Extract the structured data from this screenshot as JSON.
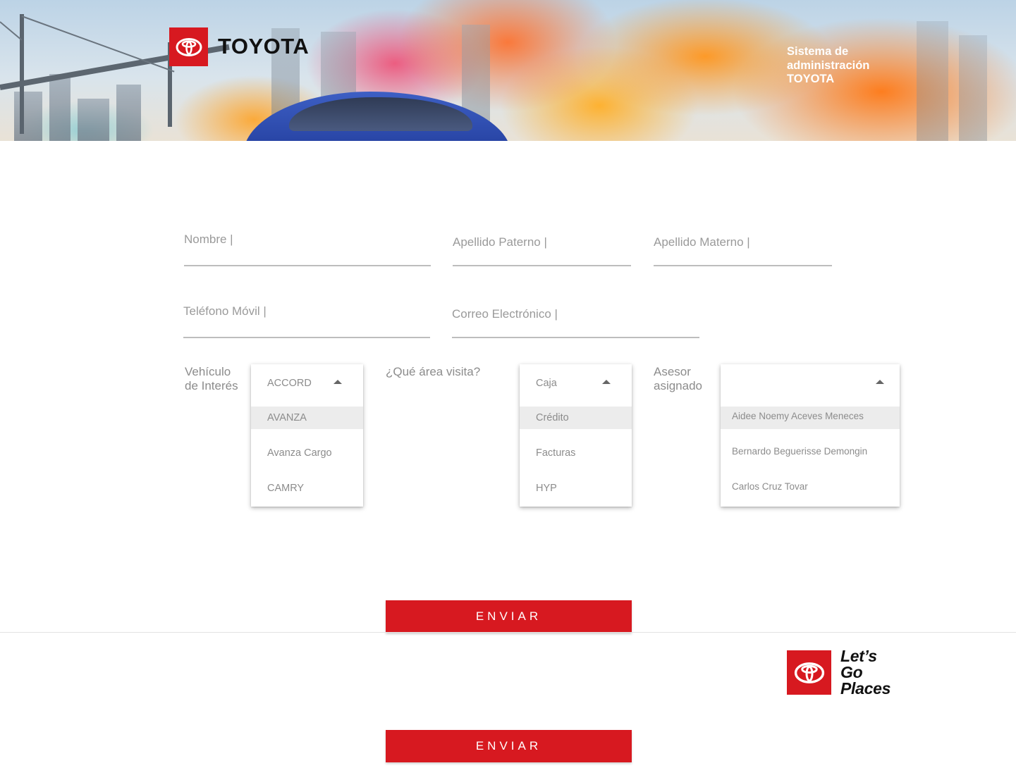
{
  "header": {
    "brand_name": "TOYOTA",
    "system_title": [
      "Sistema de",
      "administración",
      "TOYOTA"
    ]
  },
  "form": {
    "nombre": {
      "placeholder": "Nombre |"
    },
    "apellido_paterno": {
      "placeholder": "Apellido Paterno |"
    },
    "apellido_materno": {
      "placeholder": "Apellido Materno |"
    },
    "telefono": {
      "placeholder": "Teléfono Móvil |"
    },
    "correo": {
      "placeholder": "Correo Electrónico |"
    },
    "vehiculo": {
      "label": [
        "Vehículo",
        "de Interés"
      ],
      "selected": "ACCORD",
      "options": [
        "AVANZA",
        "Avanza Cargo",
        "CAMRY"
      ]
    },
    "area": {
      "label": "¿Qué área visita?",
      "selected": "Caja",
      "options": [
        "Crédito",
        "Facturas",
        "HYP"
      ]
    },
    "asesor": {
      "label": [
        "Asesor",
        "asignado"
      ],
      "selected": "",
      "options": [
        "Aidee Noemy Aceves Meneces",
        "Bernardo Beguerisse Demongin",
        "Carlos Cruz Tovar"
      ]
    },
    "submit_label": "ENVIAR"
  },
  "footer": {
    "tagline": [
      "Let’s",
      "Go",
      "Places"
    ],
    "submit_label": "ENVIAR"
  },
  "colors": {
    "brand_red": "#d71920",
    "text_gray": "#8c8c8c",
    "highlight": "#ececec"
  },
  "icons": [
    "toyota-emblem-icon",
    "caret-up-icon"
  ]
}
